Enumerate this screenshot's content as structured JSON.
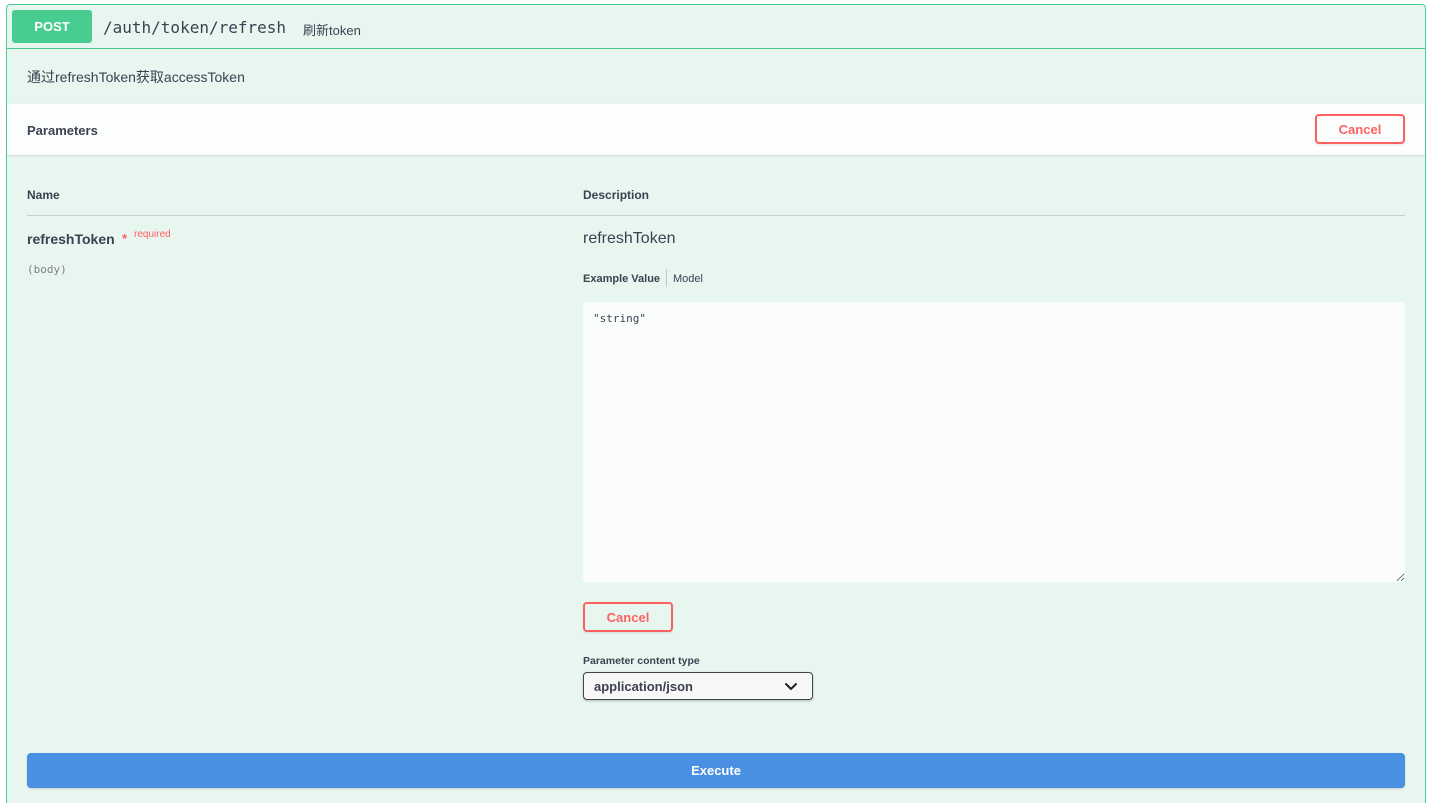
{
  "operation": {
    "method": "POST",
    "path": "/auth/token/refresh",
    "summary": "刷新token",
    "description": "通过refreshToken获取accessToken"
  },
  "parameters_section": {
    "title": "Parameters",
    "cancel_label": "Cancel",
    "columns": {
      "name": "Name",
      "description": "Description"
    }
  },
  "parameter": {
    "name": "refreshToken",
    "required_star": "*",
    "required_label": "required",
    "location": "(body)",
    "description": "refreshToken",
    "tabs": {
      "example": "Example Value",
      "model": "Model"
    },
    "body_value": "\"string\"",
    "cancel_label": "Cancel",
    "content_type_label": "Parameter content type",
    "content_type_value": "application/json"
  },
  "execute_label": "Execute",
  "colors": {
    "method_post": "#49cc90",
    "cancel": "#ff6060",
    "execute": "#4990e2",
    "block_bg": "#e8f6f0"
  }
}
